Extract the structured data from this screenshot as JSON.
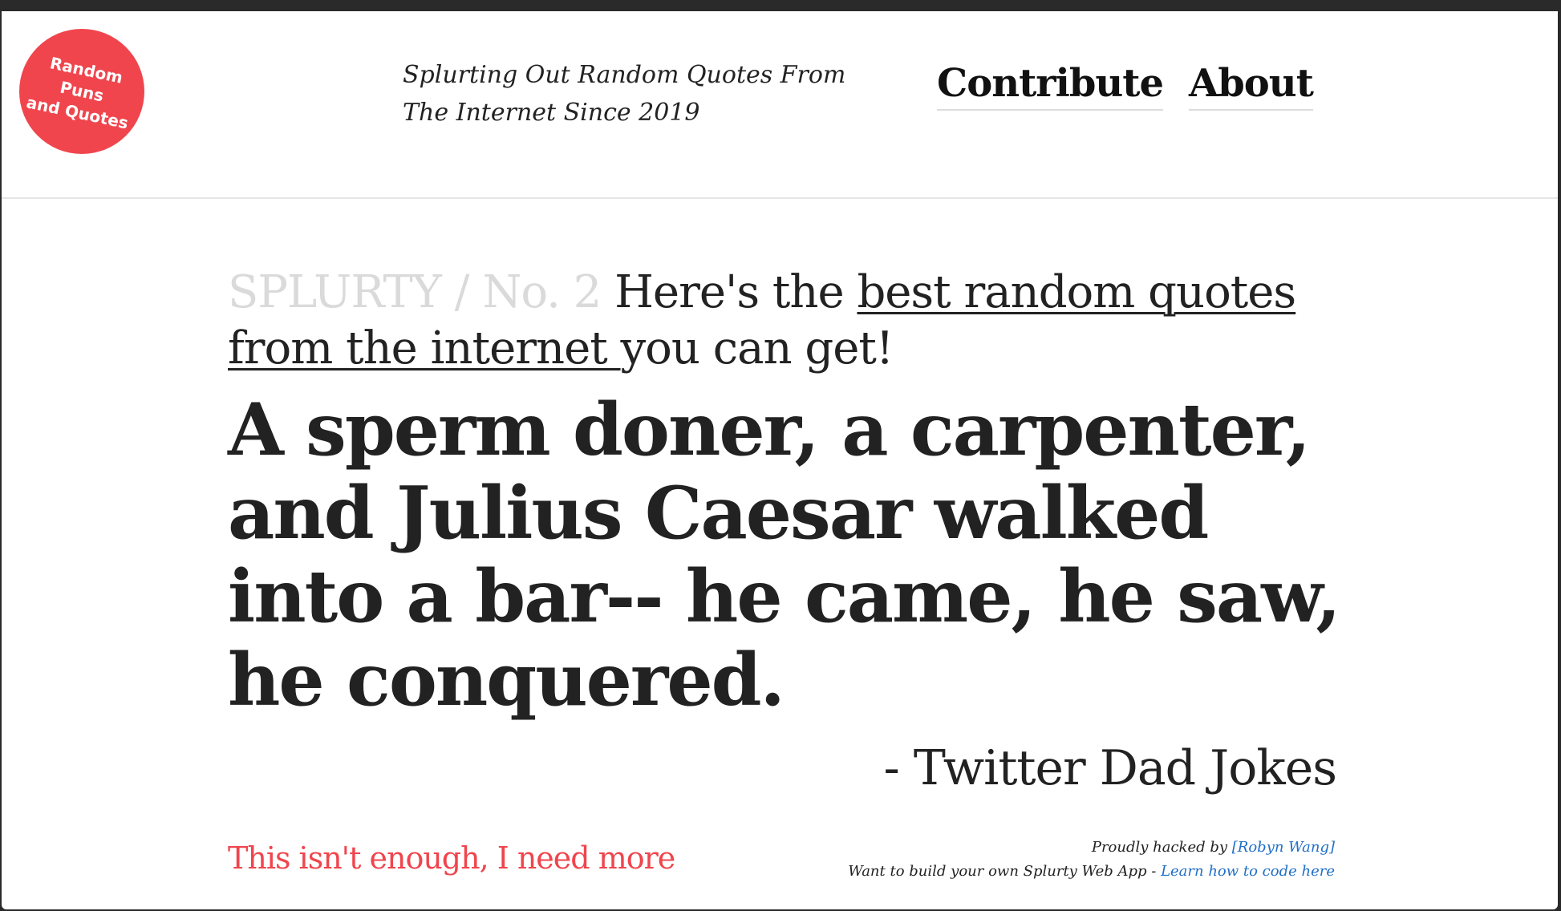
{
  "header": {
    "logo": {
      "lines": [
        "Random",
        "Puns",
        "and Quotes"
      ]
    },
    "tagline": "Splurting Out Random Quotes From The Internet Since 2019",
    "nav": [
      {
        "label": "Contribute"
      },
      {
        "label": "About"
      }
    ]
  },
  "intro": {
    "brand": "SPLURTY / No. 2",
    "prefix": " Here's the ",
    "link_text": "best random quotes from the internet ",
    "suffix": "you can get!"
  },
  "quote": {
    "text": "A sperm doner, a carpenter, and Julius Caesar walked into a bar-- he came, he saw, he conquered.",
    "author": "- Twitter Dad Jokes"
  },
  "footer": {
    "more_label": "This isn't enough, I need more",
    "credit_prefix": "Proudly hacked by ",
    "credit_link": "[Robyn Wang]",
    "build_prefix": "Want to build your own Splurty Web App - ",
    "build_link": "Learn how to code here"
  },
  "colors": {
    "accent": "#f0454d",
    "link_blue": "#1f6fc7",
    "text": "#222222",
    "brand_muted": "#dadada"
  }
}
